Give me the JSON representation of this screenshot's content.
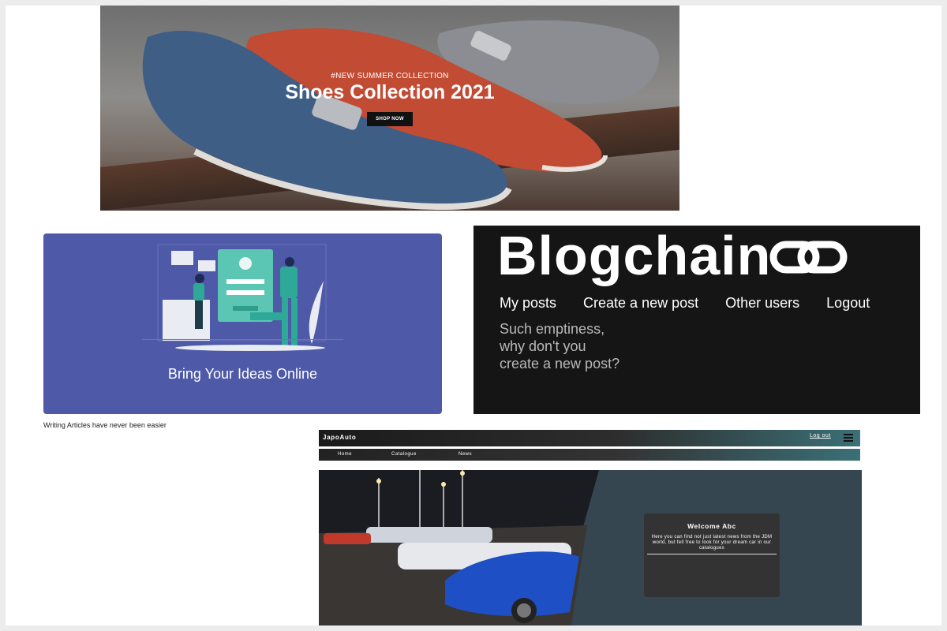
{
  "shoes_banner": {
    "tag": "#NEW SUMMER COLLECTION",
    "title": "Shoes Collection 2021",
    "button": "SHOP NOW"
  },
  "ideas_card": {
    "caption": "Bring Your Ideas Online",
    "subtitle": "Writing Articles have never been easier",
    "accent": "#4e59a8"
  },
  "blogchain": {
    "logo": "Blogchain",
    "nav": [
      "My posts",
      "Create a new post",
      "Other users",
      "Logout"
    ],
    "empty_message": "Such emptiness, why don't you create a new post?"
  },
  "japoauto": {
    "brand": "JapoAuto",
    "logout": "Log out",
    "menu": [
      "Home",
      "Catalogue",
      "News"
    ],
    "welcome_title": "Welcome Abc",
    "welcome_text": "Here you can find not just latest news from the JDM world, but fell free to look for your dream car in our catalogues",
    "accent": "#3a7077"
  }
}
